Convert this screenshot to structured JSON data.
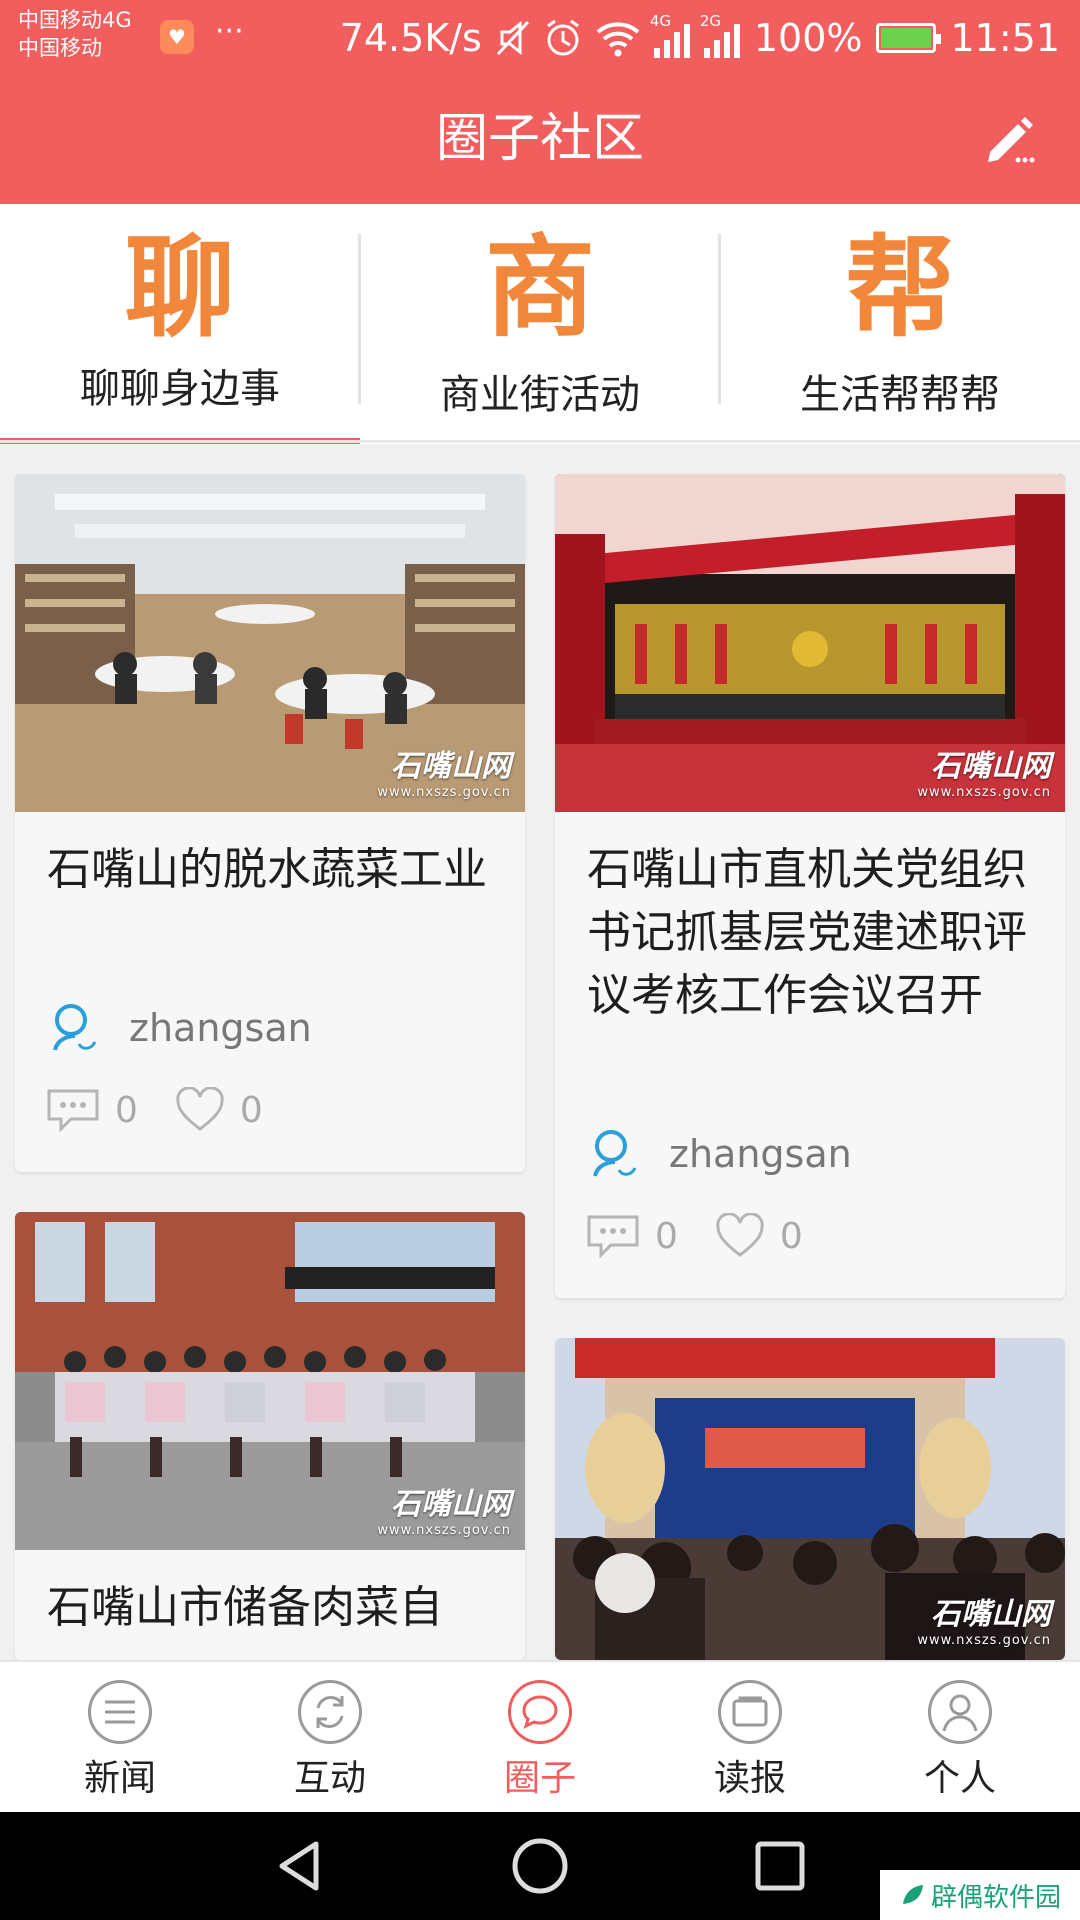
{
  "status_bar": {
    "carrier_line1": "中国移动4G",
    "carrier_line2": "中国移动",
    "more": "···",
    "net_speed": "74.5K/s",
    "signal1_tag": "4G",
    "signal2_tag": "2G",
    "battery": "100%",
    "time": "11:51"
  },
  "header": {
    "title": "圈子社区",
    "edit_icon": "pencil-icon"
  },
  "categories": [
    {
      "glyph": "聊",
      "label": "聊聊身边事",
      "active": true
    },
    {
      "glyph": "商",
      "label": "商业街活动",
      "active": false
    },
    {
      "glyph": "帮",
      "label": "生活帮帮帮",
      "active": false
    }
  ],
  "posts": [
    {
      "title": "石嘴山的脱水蔬菜工业",
      "author": "zhangsan",
      "comments": "0",
      "likes": "0",
      "watermark_name": "石嘴山网",
      "watermark_url": "www.nxszs.gov.cn"
    },
    {
      "title": "石嘴山市直机关党组织书记抓基层党建述职评议考核工作会议召开",
      "author": "zhangsan",
      "comments": "0",
      "likes": "0",
      "watermark_name": "石嘴山网",
      "watermark_url": "www.nxszs.gov.cn"
    },
    {
      "title": "石嘴山市储备肉菜自",
      "watermark_name": "石嘴山网",
      "watermark_url": "www.nxszs.gov.cn"
    },
    {
      "watermark_name": "石嘴山网",
      "watermark_url": "www.nxszs.gov.cn"
    }
  ],
  "bottom_nav": [
    {
      "label": "新闻",
      "icon": "menu-icon",
      "active": false
    },
    {
      "label": "互动",
      "icon": "refresh-icon",
      "active": false
    },
    {
      "label": "圈子",
      "icon": "chat-bubble-icon",
      "active": true
    },
    {
      "label": "读报",
      "icon": "newspaper-icon",
      "active": false
    },
    {
      "label": "个人",
      "icon": "person-icon",
      "active": false
    }
  ],
  "site_watermark": "辟偶软件园",
  "colors": {
    "accent": "#f25e5e",
    "glyph_orange": "#f0873a"
  }
}
